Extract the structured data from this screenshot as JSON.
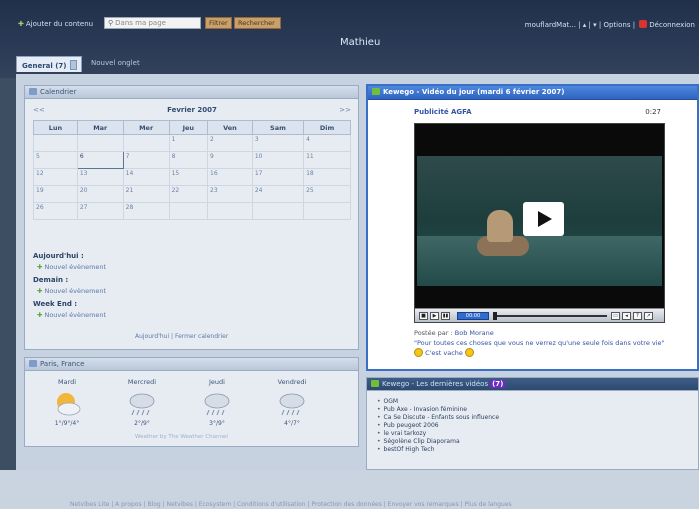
{
  "header": {
    "add_content": "Ajouter du contenu",
    "search_placeholder": "Dans ma page",
    "filter_button": "Filtrer",
    "search_button": "Rechercher",
    "username": "mouflardMat...",
    "separator": "|",
    "options": "Options",
    "logout": "Déconnexion"
  },
  "page": {
    "title": "Mathieu"
  },
  "tabs": [
    {
      "label": "General (7)"
    },
    {
      "label": "Nouvel onglet"
    }
  ],
  "calendar": {
    "title": "Calendrier",
    "prev": "<<",
    "next": ">>",
    "month": "Fevrier 2007",
    "weekdays": [
      "Lun",
      "Mar",
      "Mer",
      "Jeu",
      "Ven",
      "Sam",
      "Dim"
    ],
    "weeks": [
      [
        "",
        "",
        "",
        "1",
        "2",
        "3",
        "4"
      ],
      [
        "5",
        "6",
        "7",
        "8",
        "9",
        "10",
        "11"
      ],
      [
        "12",
        "13",
        "14",
        "15",
        "16",
        "17",
        "18"
      ],
      [
        "19",
        "20",
        "21",
        "22",
        "23",
        "24",
        "25"
      ],
      [
        "26",
        "27",
        "28",
        "",
        "",
        "",
        ""
      ]
    ],
    "today": "6",
    "today_label": "Aujourd'hui :",
    "tomorrow_label": "Demain :",
    "weekend_label": "Week End :",
    "new_event": "Nouvel évènement",
    "links": "Aujourd'hui | Fermer calendrier"
  },
  "weather": {
    "title": "Paris, France",
    "days": [
      {
        "name": "Mardi",
        "temp": "1°/9°/4°",
        "icon": "partly-cloudy-icon"
      },
      {
        "name": "Mercredi",
        "temp": "2°/9°",
        "icon": "rain-icon"
      },
      {
        "name": "Jeudi",
        "temp": "3°/9°",
        "icon": "rain-icon"
      },
      {
        "name": "Vendredi",
        "temp": "4°/7°",
        "icon": "rain-icon"
      }
    ],
    "credit": "Weather by The Weather Channel"
  },
  "video": {
    "title": "Kewego - Vidéo du jour (mardi 6 février 2007)",
    "clip_title": "Publicité AGFA",
    "duration": "0:27",
    "time": "00:00",
    "posted_by_label": "Postée par :",
    "posted_by": "Bob Morane",
    "comment": "\"Pour toutes ces choses que vous ne verrez qu'une seule fois dans votre vie\"",
    "comment_end": "C'est vache"
  },
  "latest": {
    "title": "Kewego - Les dernières vidéos",
    "count": "(7)",
    "items": [
      "OGM",
      "Pub Axe - Invasion féminine",
      "Ca Se Discute - Enfants sous influence",
      "Pub peugeot 2006",
      "le vrai tarkozy",
      "Ségolène Clip Diaporama",
      "bestOf High Tech"
    ]
  },
  "footer": {
    "links": "Netvibes Lite | A propos | Blog | Netvibes | Ecosystem | Conditions d'utilisation | Protection des données | Envoyer vos remarques | Plus de langues"
  },
  "colors": {
    "header_bg": "#2b3a56",
    "video_accent": "#3a6fc6",
    "button": "#c9a06a"
  }
}
